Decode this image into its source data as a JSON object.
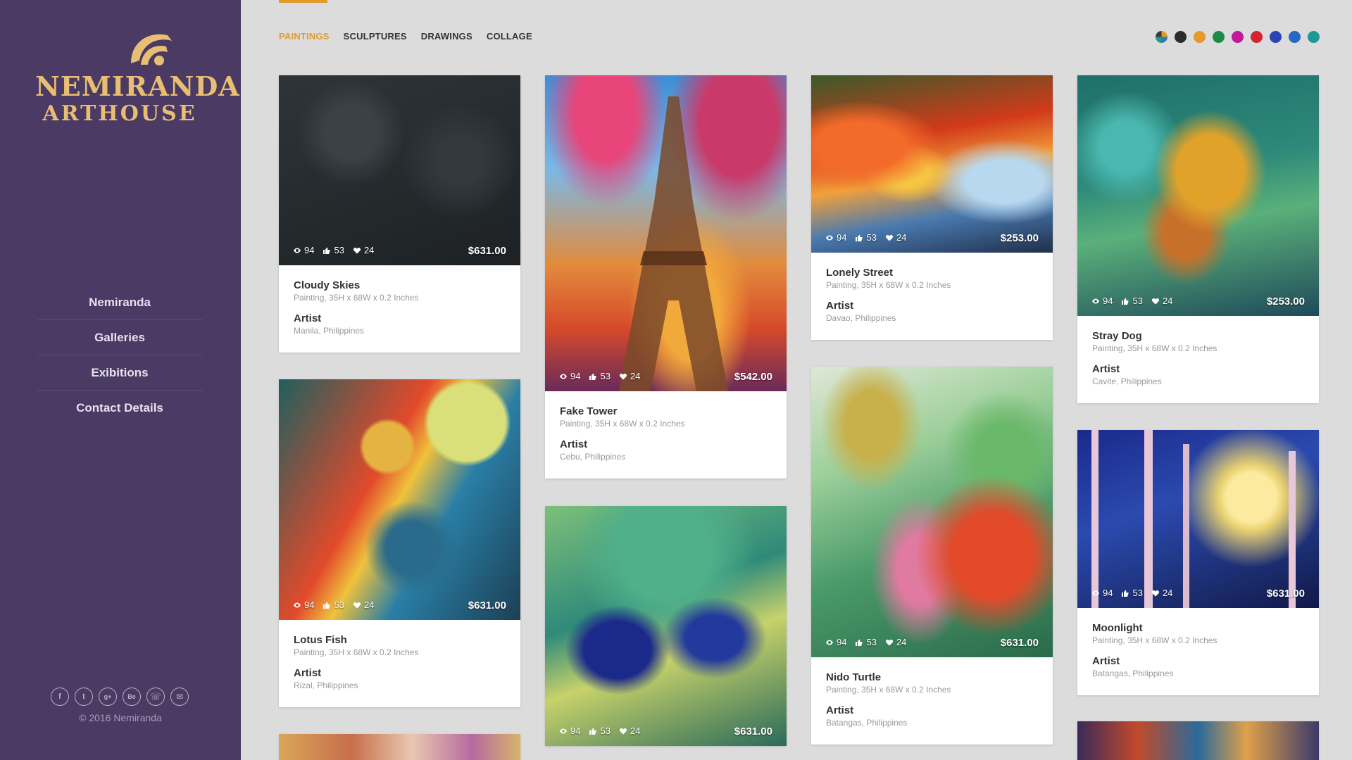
{
  "brand": {
    "line1": "NEMIRANDA",
    "line2": "ARTHOUSE"
  },
  "nav": [
    "Nemiranda",
    "Galleries",
    "Exibitions",
    "Contact Details"
  ],
  "social": [
    {
      "name": "facebook-icon",
      "glyph": "f"
    },
    {
      "name": "twitter-icon",
      "glyph": "t"
    },
    {
      "name": "google-plus-icon",
      "glyph": "g+"
    },
    {
      "name": "behance-icon",
      "glyph": "Be"
    },
    {
      "name": "phone-icon",
      "glyph": "☏"
    },
    {
      "name": "mail-icon",
      "glyph": "✉"
    }
  ],
  "copyright": "© 2016 Nemiranda",
  "tabs": [
    "PAINTINGS",
    "SCULPTURES",
    "DRAWINGS",
    "COLLAGE"
  ],
  "active_tab": 0,
  "swatches": [
    "multi",
    "#2c2c2c",
    "#e29a2b",
    "#1e8a4a",
    "#c0199a",
    "#d4242f",
    "#2b44b5",
    "#2569c4",
    "#1a9a95"
  ],
  "cards": {
    "cloudy": {
      "title": "Cloudy Skies",
      "meta": "Painting, 35H x 68W x 0.2 Inches",
      "artist": "Artist",
      "location": "Manila, Philippines",
      "views": "94",
      "likes": "53",
      "favs": "24",
      "price": "$631.00"
    },
    "lotus": {
      "title": "Lotus Fish",
      "meta": "Painting, 35H x 68W x 0.2 Inches",
      "artist": "Artist",
      "location": "Rizal, Philippines",
      "views": "94",
      "likes": "53",
      "favs": "24",
      "price": "$631.00"
    },
    "tower": {
      "title": "Fake Tower",
      "meta": "Painting, 35H x 68W x 0.2 Inches",
      "artist": "Artist",
      "location": "Cebu, Philippines",
      "views": "94",
      "likes": "53",
      "favs": "24",
      "price": "$542.00"
    },
    "peacock": {
      "title": "",
      "meta": "",
      "artist": "",
      "location": "",
      "views": "94",
      "likes": "53",
      "favs": "24",
      "price": "$631.00"
    },
    "street": {
      "title": "Lonely Street",
      "meta": "Painting, 35H x 68W x 0.2 Inches",
      "artist": "Artist",
      "location": "Davao, Philippines",
      "views": "94",
      "likes": "53",
      "favs": "24",
      "price": "$253.00"
    },
    "turtle": {
      "title": "Nido Turtle",
      "meta": "Painting, 35H x 68W x 0.2 Inches",
      "artist": "Artist",
      "location": "Batangas, Philippines",
      "views": "94",
      "likes": "53",
      "favs": "24",
      "price": "$631.00"
    },
    "dog": {
      "title": "Stray Dog",
      "meta": "Painting, 35H x 68W x 0.2 Inches",
      "artist": "Artist",
      "location": "Cavite, Philippines",
      "views": "94",
      "likes": "53",
      "favs": "24",
      "price": "$253.00"
    },
    "moon": {
      "title": "Moonlight",
      "meta": "Painting, 35H x 68W x 0.2 Inches",
      "artist": "Artist",
      "location": "Batangas, Philippines",
      "views": "94",
      "likes": "53",
      "favs": "24",
      "price": "$631.00"
    }
  }
}
